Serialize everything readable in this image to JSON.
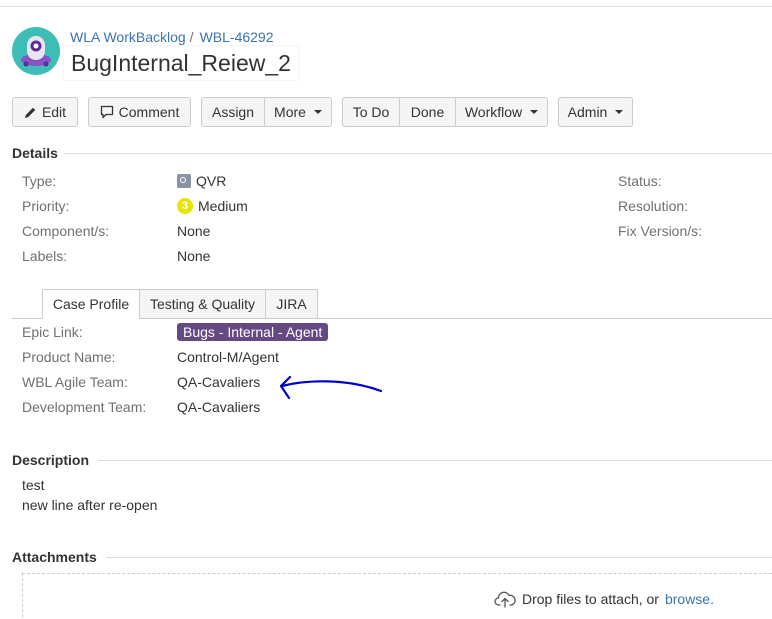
{
  "breadcrumb": {
    "project": "WLA WorkBacklog",
    "issue_key": "WBL-46292"
  },
  "issue": {
    "title": "BugInternal_Reiew_2"
  },
  "toolbar": {
    "edit": "Edit",
    "comment": "Comment",
    "assign": "Assign",
    "more": "More",
    "todo": "To Do",
    "done": "Done",
    "workflow": "Workflow",
    "admin": "Admin"
  },
  "details": {
    "heading": "Details",
    "type": {
      "label": "Type:",
      "value": "QVR"
    },
    "priority": {
      "label": "Priority:",
      "value": "Medium",
      "icon_text": "3"
    },
    "components": {
      "label": "Component/s:",
      "value": "None"
    },
    "labels": {
      "label": "Labels:",
      "value": "None"
    },
    "status": {
      "label": "Status:"
    },
    "resolution": {
      "label": "Resolution:"
    },
    "fix_version": {
      "label": "Fix Version/s:"
    }
  },
  "tabs": [
    "Case Profile",
    "Testing & Quality",
    "JIRA"
  ],
  "case_profile": {
    "epic_link": {
      "label": "Epic Link:",
      "value": "Bugs - Internal - Agent"
    },
    "product_name": {
      "label": "Product Name:",
      "value": "Control-M/Agent"
    },
    "agile_team": {
      "label": "WBL Agile Team:",
      "value": "QA-Cavaliers"
    },
    "dev_team": {
      "label": "Development Team:",
      "value": "QA-Cavaliers"
    }
  },
  "description": {
    "heading": "Description",
    "lines": [
      "test",
      "new line after re-open"
    ]
  },
  "attachments": {
    "heading": "Attachments",
    "drop_text": "Drop files to attach, or",
    "browse": "browse."
  },
  "colors": {
    "link": "#3b73af",
    "epic": "#654982",
    "priority_medium": "#e5e500",
    "annotation_arrow": "#0000cc"
  }
}
